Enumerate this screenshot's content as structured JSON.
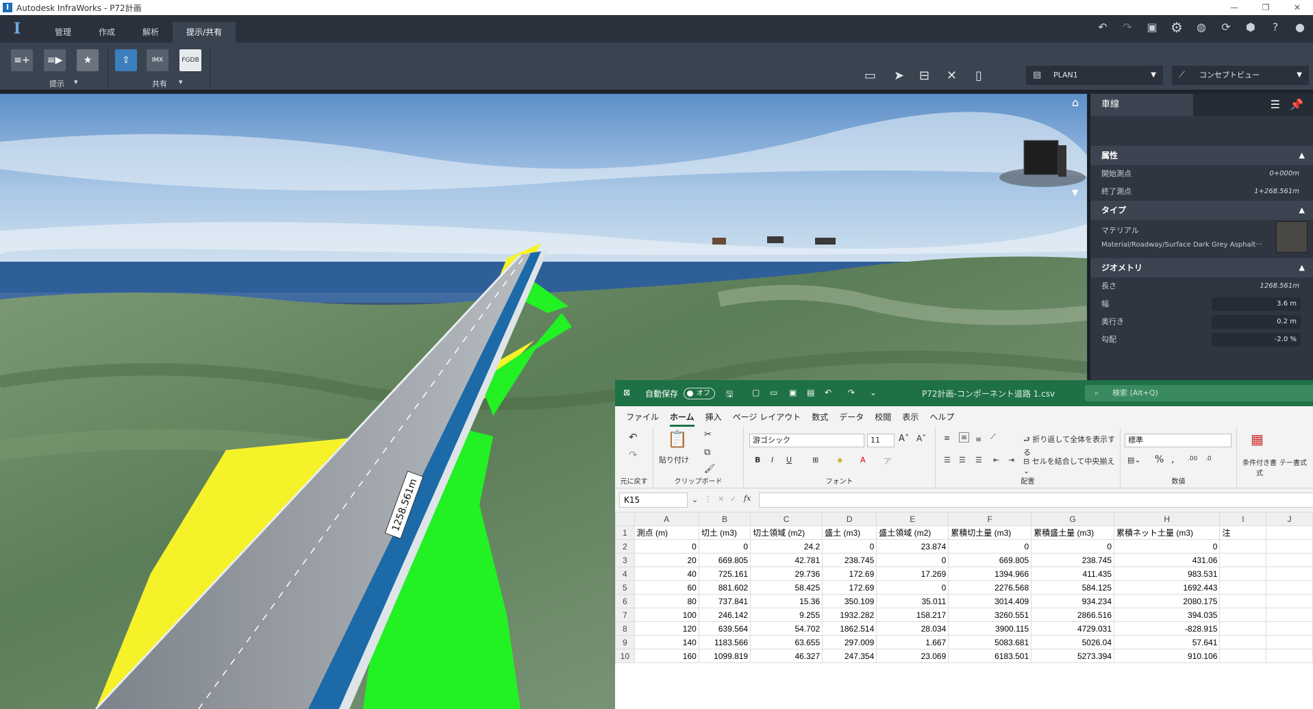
{
  "titlebar": {
    "title": "Autodesk InfraWorks - P72計画",
    "controls": [
      "—",
      "❐",
      "✕"
    ]
  },
  "menubar": {
    "app_logo": "I",
    "tabs": [
      "管理",
      "作成",
      "解析",
      "提示/共有"
    ],
    "active_tab": 3,
    "right_icons": [
      "undo-icon",
      "redo-icon",
      "model-icon",
      "settings-icon",
      "globe-icon",
      "sync-icon",
      "cloud-icon",
      "help-icon",
      "user-icon"
    ]
  },
  "ribbon": {
    "group1_label": "提示",
    "group2_label": "共有",
    "buttons": [
      "storyboard-add-icon",
      "storyboard-play-icon",
      "star-icon",
      "export-icon",
      "imx-icon",
      "fgdb-icon"
    ],
    "imx_label": "IMX",
    "fgdb_label": "FGDB",
    "view_dropdown": "PLAN1",
    "style_dropdown": "コンセプトビュー"
  },
  "viewport": {
    "road_label": "1258.561m",
    "colors": {
      "sky": "#6f9fd0",
      "sea": "#3a6ea8",
      "cut": "#f7f52a",
      "fill": "#20f020",
      "road": "#9aa0a6",
      "lane": "#1f6fb0"
    }
  },
  "panel": {
    "tab_title": "車線",
    "sections": [
      {
        "title": "属性",
        "rows": [
          {
            "label": "開始測点",
            "value": "0+000m"
          },
          {
            "label": "終了測点",
            "value": "1+268.561m"
          }
        ]
      },
      {
        "title": "タイプ",
        "rows": [
          {
            "label": "マテリアル",
            "value": ""
          },
          {
            "label": "Material/Roadway/Surface Dark Grey Asphalt···",
            "value": ""
          }
        ]
      },
      {
        "title": "ジオメトリ",
        "rows": [
          {
            "label": "長さ",
            "value": "1268.561m"
          },
          {
            "label": "幅",
            "input": "3.6  m"
          },
          {
            "label": "奥行き",
            "input": "0.2  m"
          },
          {
            "label": "勾配",
            "input": "-2.0  %"
          }
        ]
      }
    ]
  },
  "excel": {
    "autosave_label": "自動保存",
    "autosave_state": "オフ",
    "file_name": "P72計画-コンポーネント道路 1.csv",
    "search_placeholder": "検索 (Alt+Q)",
    "menu": [
      "ファイル",
      "ホーム",
      "挿入",
      "ページ レイアウト",
      "数式",
      "データ",
      "校閲",
      "表示",
      "ヘルプ"
    ],
    "active_menu": 1,
    "ribbon": {
      "undo_group": "元に戻す",
      "paste_label": "貼り付け",
      "clipboard_group": "クリップボード",
      "font_name": "游ゴシック",
      "font_size": "11",
      "font_group": "フォント",
      "wrap_label": "折り返して全体を表示する",
      "merge_label": "セルを結合して中央揃え",
      "align_group": "配置",
      "number_format": "標準",
      "number_group": "数値",
      "cond_label": "条件付き書式",
      "table_label": "テー書式"
    },
    "name_box": "K15",
    "fx_symbol": "fx",
    "columns": [
      "A",
      "B",
      "C",
      "D",
      "E",
      "F",
      "G",
      "H",
      "I",
      "J"
    ],
    "headers": [
      "測点 (m)",
      "切土 (m3)",
      "切土領域 (m2)",
      "盛土 (m3)",
      "盛土領域 (m2)",
      "累積切土量 (m3)",
      "累積盛土量 (m3)",
      "累積ネット土量 (m3)",
      "注",
      ""
    ],
    "rows": [
      [
        "0",
        "0",
        "24.2",
        "0",
        "23.874",
        "0",
        "0",
        "0"
      ],
      [
        "20",
        "669.805",
        "42.781",
        "238.745",
        "0",
        "669.805",
        "238.745",
        "431.06"
      ],
      [
        "40",
        "725.161",
        "29.736",
        "172.69",
        "17.269",
        "1394.966",
        "411.435",
        "983.531"
      ],
      [
        "60",
        "881.602",
        "58.425",
        "172.69",
        "0",
        "2276.568",
        "584.125",
        "1692.443"
      ],
      [
        "80",
        "737.841",
        "15.36",
        "350.109",
        "35.011",
        "3014.409",
        "934.234",
        "2080.175"
      ],
      [
        "100",
        "246.142",
        "9.255",
        "1932.282",
        "158.217",
        "3260.551",
        "2866.516",
        "394.035"
      ],
      [
        "120",
        "639.564",
        "54.702",
        "1862.514",
        "28.034",
        "3900.115",
        "4729.031",
        "-828.915"
      ],
      [
        "140",
        "1183.566",
        "63.655",
        "297.009",
        "1.667",
        "5083.681",
        "5026.04",
        "57.641"
      ],
      [
        "160",
        "1099.819",
        "46.327",
        "247.354",
        "23.069",
        "6183.501",
        "5273.394",
        "910.106"
      ]
    ]
  }
}
